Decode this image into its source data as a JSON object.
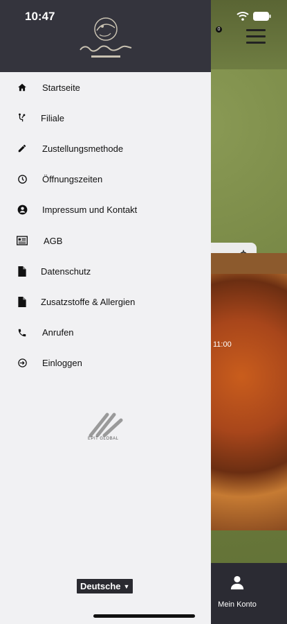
{
  "status": {
    "time": "10:47"
  },
  "menu": {
    "items": [
      {
        "label": "Startseite",
        "icon": "home-icon"
      },
      {
        "label": "Filiale",
        "icon": "branch-icon"
      },
      {
        "label": "Zustellungsmethode",
        "icon": "pencil-icon"
      },
      {
        "label": "Öffnungszeiten",
        "icon": "clock-icon"
      },
      {
        "label": "Impressum und Kontakt",
        "icon": "account-circle-icon"
      },
      {
        "label": "AGB",
        "icon": "document-list-icon"
      },
      {
        "label": "Datenschutz",
        "icon": "file-icon"
      },
      {
        "label": "Zusatzstoffe & Allergien",
        "icon": "file-icon"
      },
      {
        "label": "Anrufen",
        "icon": "phone-icon"
      },
      {
        "label": "Einloggen",
        "icon": "login-icon"
      }
    ]
  },
  "footer": {
    "language": "Deutsche",
    "brand_text": "EPIT GLOBAL"
  },
  "background_app": {
    "time_badge": "11:00",
    "account_label": "Mein Konto",
    "cart_count": "0"
  },
  "colors": {
    "drawer_header": "#34343d",
    "drawer_bg": "#f1f1f3",
    "bottom_bar": "#2b2b33"
  }
}
